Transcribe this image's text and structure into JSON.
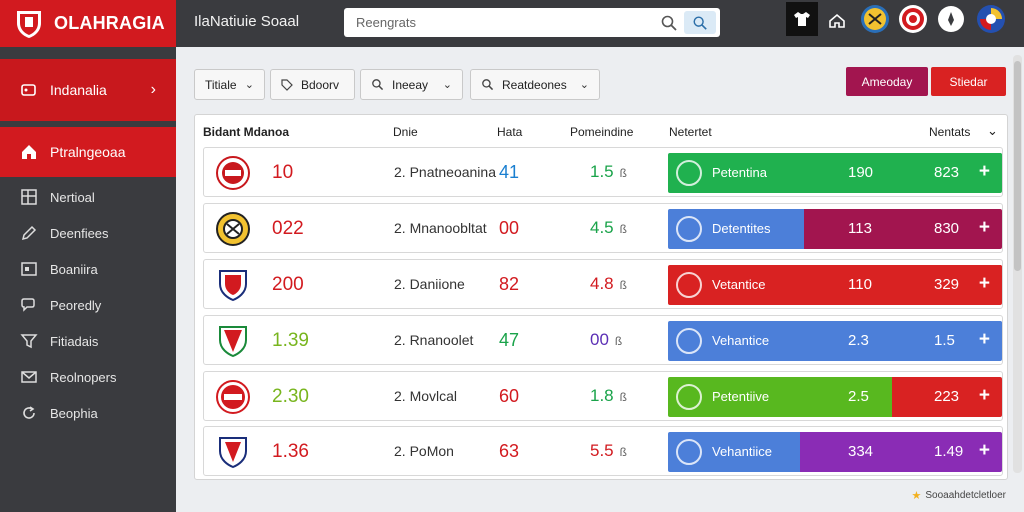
{
  "brand": {
    "name": "OLAHRAGIA"
  },
  "header": {
    "title": "IlaNatiuie Soaal",
    "search_placeholder": "Reengrats"
  },
  "sidebar": {
    "top_item": "Indanalia",
    "active_item": "Ptralngeoaa",
    "items": [
      {
        "label": "Nertioal",
        "icon": "grid-icon"
      },
      {
        "label": "Deenfiees",
        "icon": "edit-icon"
      },
      {
        "label": "Boaniira",
        "icon": "box-icon"
      },
      {
        "label": "Peoredly",
        "icon": "chat-icon"
      },
      {
        "label": "Fitiadais",
        "icon": "filter-icon"
      },
      {
        "label": "Reolnopers",
        "icon": "mail-icon"
      },
      {
        "label": "Beophia",
        "icon": "refresh-icon"
      }
    ]
  },
  "filters": [
    {
      "label": "Titiale"
    },
    {
      "label": "Bdoorv"
    },
    {
      "label": "Ineeay"
    },
    {
      "label": "Reatdeones"
    }
  ],
  "actions": {
    "primary": "Ameoday",
    "secondary": "Stiedar"
  },
  "table": {
    "columns": {
      "name": "Bidant Mdanoa",
      "date": "Dnie",
      "rate": "Hata",
      "percent": "Pomeindine",
      "market": "Netertet",
      "right": "Nentats"
    },
    "rows": [
      {
        "score": "10",
        "score_color": "#d21a1f",
        "team": "2. Pnatneoanina",
        "val1": "41",
        "val1_color": "#1a7fd0",
        "val2": "1.5",
        "val2_color": "#1aa34a",
        "val2_suffix": "ß",
        "bar_label": "Petentina",
        "n1": "190",
        "n2": "823",
        "left_color": "#20b14f",
        "right_color": "#20b14f"
      },
      {
        "score": "022",
        "score_color": "#d21a1f",
        "team": "2. Mnanoobltat",
        "val1": "00",
        "val1_color": "#d21a1f",
        "val2": "4.5",
        "val2_color": "#1aa34a",
        "val2_suffix": "ß",
        "bar_label": "Detentites",
        "n1": "113",
        "n2": "830",
        "left_color": "#4c7fd9",
        "right_color": "#a2154f"
      },
      {
        "score": "200",
        "score_color": "#d21a1f",
        "team": "2. Daniione",
        "val1": "82",
        "val1_color": "#d21a1f",
        "val2": "4.8",
        "val2_color": "#d21a1f",
        "val2_suffix": "ß",
        "bar_label": "Vetantice",
        "n1": "110",
        "n2": "329",
        "left_color": "#d92222",
        "right_color": "#d92222"
      },
      {
        "score": "1.39",
        "score_color": "#78b51e",
        "team": "2. Rnanoolet",
        "val1": "47",
        "val1_color": "#1aa34a",
        "val2": "00",
        "val2_color": "#5b2fb5",
        "val2_suffix": "ß",
        "bar_label": "Vehantice",
        "n1": "2.3",
        "n2": "1.5",
        "left_color": "#4c7fd9",
        "right_color": "#4c7fd9"
      },
      {
        "score": "2.30",
        "score_color": "#78b51e",
        "team": "2. Movlcal",
        "val1": "60",
        "val1_color": "#d21a1f",
        "val2": "1.8",
        "val2_color": "#1aa34a",
        "val2_suffix": "ß",
        "bar_label": "Petentiive",
        "n1": "2.5",
        "n2": "223",
        "left_color": "#58b81f",
        "right_color": "#d92222"
      },
      {
        "score": "1.36",
        "score_color": "#d21a1f",
        "team": "2. PoMon",
        "val1": "63",
        "val1_color": "#d21a1f",
        "val2": "5.5",
        "val2_color": "#d21a1f",
        "val2_suffix": "ß",
        "bar_label": "Vehantiice",
        "n1": "334",
        "n2": "1.49",
        "left_color": "#4c7fd9",
        "right_color": "#8a2cb5"
      }
    ]
  },
  "footer": {
    "text": "Sooaahdetcletloer"
  }
}
